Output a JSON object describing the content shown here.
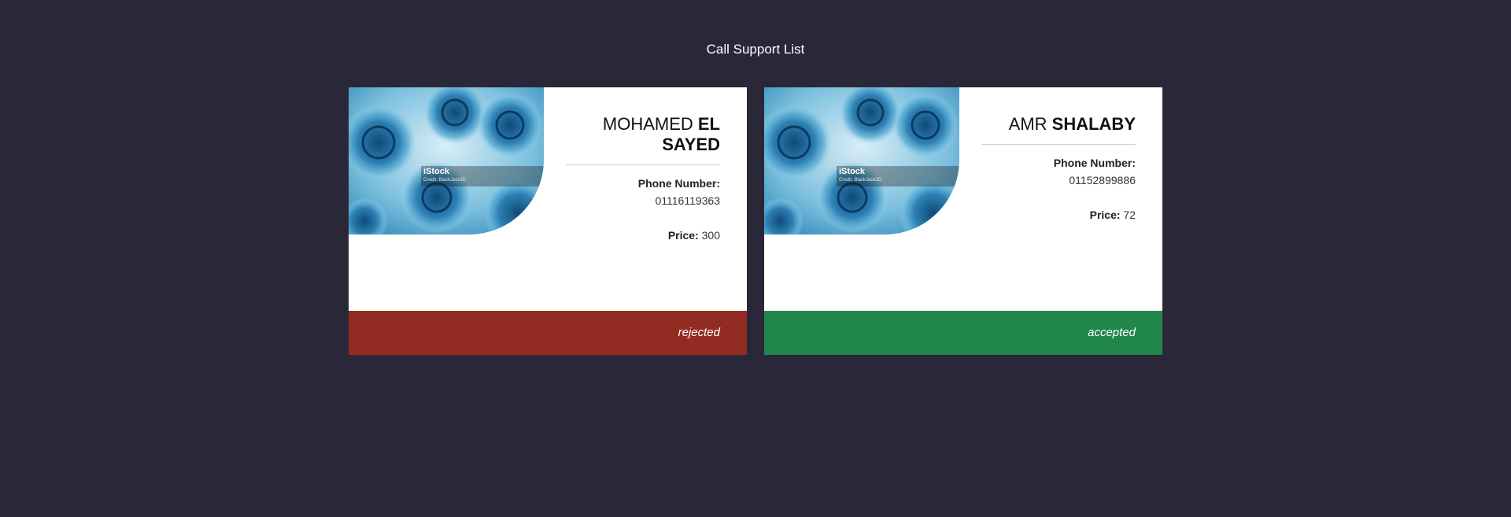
{
  "page": {
    "title": "Call Support List",
    "background": "#2a2838"
  },
  "cards": [
    {
      "image_icon": "virus-cells-photo",
      "image_watermark": "iStock",
      "image_credit": "Credit: BlackJack3D",
      "first_name": "MOHAMED ",
      "last_name": "EL SAYED",
      "phone_label": "Phone Number:",
      "phone": "01116119363",
      "price_label": "Price:",
      "price": "300",
      "status": "rejected",
      "status_color": "#922c22"
    },
    {
      "image_icon": "virus-cells-photo",
      "image_watermark": "iStock",
      "image_credit": "Credit: BlackJack3D",
      "first_name": "AMR ",
      "last_name": "SHALABY",
      "phone_label": "Phone Number:",
      "phone": "01152899886",
      "price_label": "Price:",
      "price": "72",
      "status": "accepted",
      "status_color": "#20864c"
    }
  ]
}
